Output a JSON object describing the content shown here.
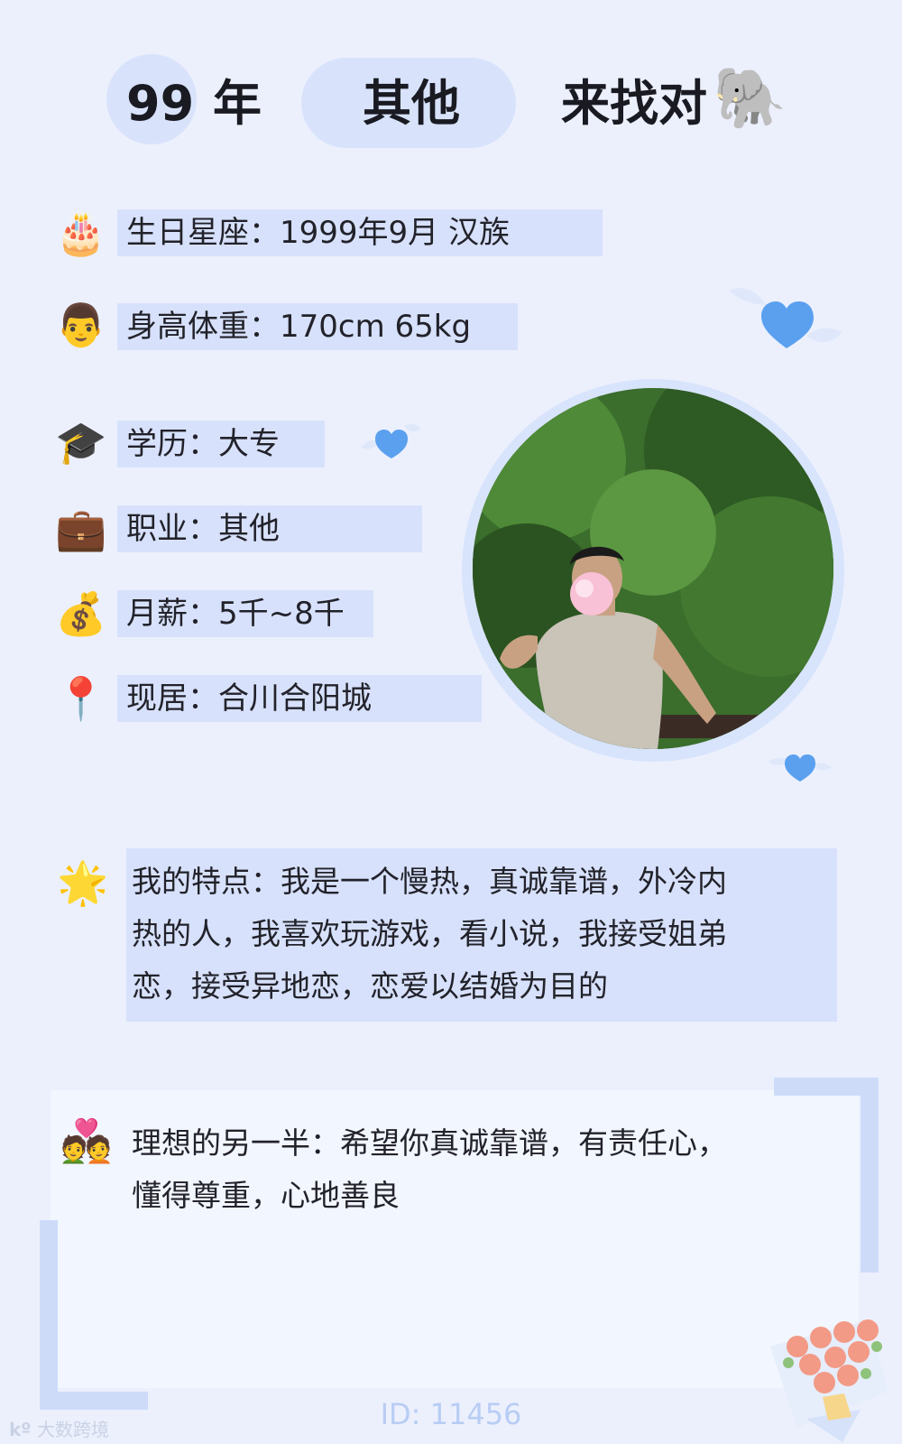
{
  "header": {
    "year_number": "99",
    "year_suffix": "年",
    "occupation_pill": "其他",
    "tagline": "来找对",
    "tagline_emoji": "🐘"
  },
  "info_rows": [
    {
      "icon": "cake-icon",
      "emoji": "🎂",
      "text": "生日星座：1999年9月 汉族"
    },
    {
      "icon": "man-face-icon",
      "emoji": "👨",
      "text": "身高体重：170cm 65kg"
    },
    {
      "icon": "graduation-cap-icon",
      "emoji": "🎓",
      "text": "学历：大专"
    },
    {
      "icon": "briefcase-icon",
      "emoji": "💼",
      "text": "职业：其他"
    },
    {
      "icon": "money-bag-icon",
      "emoji": "💰",
      "text": "月薪：5千~8千"
    },
    {
      "icon": "location-pin-icon",
      "emoji": "📍",
      "text": "现居：合川合阳城"
    }
  ],
  "features": {
    "icon": "star-icon",
    "emoji": "🌟",
    "lines": [
      "我的特点：我是一个慢热，真诚靠谱，外冷内",
      "热的人，我喜欢玩游戏，看小说，我接受姐弟",
      "恋，接受异地恋，恋爱以结婚为目的"
    ]
  },
  "ideal_partner": {
    "icon": "couple-with-heart-icon",
    "emoji": "💑",
    "lines": [
      "理想的另一半：希望你真诚靠谱，有责任心，",
      "懂得尊重，心地善良"
    ]
  },
  "footer": {
    "id_text": "ID: 11456",
    "watermark": "大数跨境"
  },
  "colors": {
    "background": "#ecf0fd",
    "band": "#d7e1fb",
    "accent_blue": "#5aa0ef",
    "id_text": "#b8cdf4"
  }
}
